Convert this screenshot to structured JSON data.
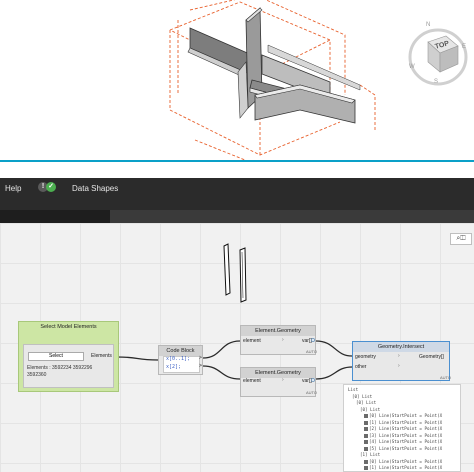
{
  "viewport": {
    "viewcube": {
      "face_label": "TOP",
      "compass": [
        "N",
        "E",
        "S",
        "W"
      ]
    },
    "accent_color": "#e8602c"
  },
  "menu": {
    "help": "Help",
    "data_shapes": "Data Shapes"
  },
  "notifications": {
    "warning_icon": "!",
    "ok_icon": "✓",
    "warning_color": "#5a5a5a",
    "ok_color": "#4caf50"
  },
  "nodes": {
    "select_model_elements": {
      "title": "Select Model Elements",
      "button": "Select",
      "output": "Elements",
      "elements_label": "Elements : 3592234 3592296",
      "elements_label_2": "3592360"
    },
    "code_block": {
      "title": "Code Block",
      "line1": "x[0..1];",
      "line2": "x[2];",
      "port1": ">",
      "port2": ">"
    },
    "element_geometry_1": {
      "title": "Element.Geometry",
      "input": "element",
      "output": "var[]",
      "footer": "AUTO"
    },
    "element_geometry_2": {
      "title": "Element.Geometry",
      "input": "element",
      "output": "var[]",
      "footer": "AUTO"
    },
    "geometry_intersect": {
      "title": "Geometry.Intersect",
      "input1": "geometry",
      "input2": "other",
      "output": "Geometry[]",
      "footer": "AUTO"
    }
  },
  "watch": {
    "lines": [
      "List",
      "  [0] List",
      "    [0] List",
      "      [0] List",
      "        [0] Line(StartPoint = Point(X",
      "        [1] Line(StartPoint = Point(X",
      "        [2] Line(StartPoint = Point(X",
      "        [3] Line(StartPoint = Point(X",
      "        [4] Line(StartPoint = Point(X",
      "        [5] Line(StartPoint = Point(X",
      "      [1] List",
      "        [0] Line(StartPoint = Point(X",
      "        [1] Line(StartPoint = Point(X"
    ]
  }
}
